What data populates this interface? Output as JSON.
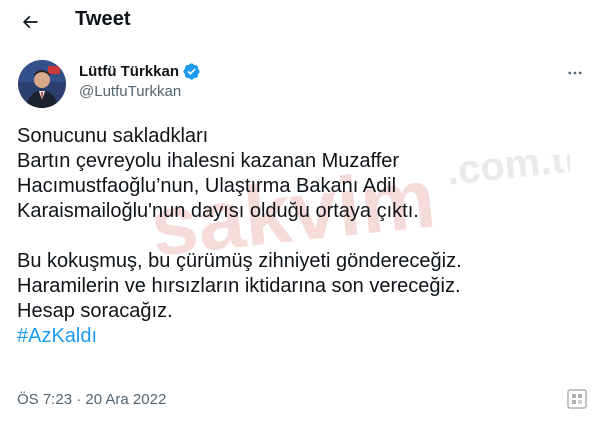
{
  "header": {
    "title": "Tweet"
  },
  "author": {
    "display_name": "Lütfü Türkkan",
    "handle": "@LutfuTurkkan"
  },
  "tweet": {
    "lines_1": [
      "Sonucunu sakladkları",
      "Bartın çevreyolu ihalesni kazanan Muzaffer",
      "Hacımustfaoğlu’nun, Ulaştırma Bakanı Adil",
      "Karaismailoğlu'nun dayısı olduğu ortaya çıktı."
    ],
    "lines_2": [
      "Bu kokuşmuş, bu çürümüş zihniyeti göndereceğiz.",
      "Haramilerin ve hırsızların iktidarına son vereceğiz.",
      "Hesap soracağız."
    ],
    "hashtag": "#AzKaldı"
  },
  "meta": {
    "time": "ÖS 7:23",
    "separator": "·",
    "date": "20 Ara 2022"
  },
  "watermark": {
    "text": "sakvim.com.tr"
  },
  "colors": {
    "link": "#1d9bf0",
    "secondary": "#536471",
    "verified": "#1d9bf0"
  },
  "icons": [
    "back-arrow-icon",
    "verified-badge-icon",
    "more-options-icon"
  ]
}
